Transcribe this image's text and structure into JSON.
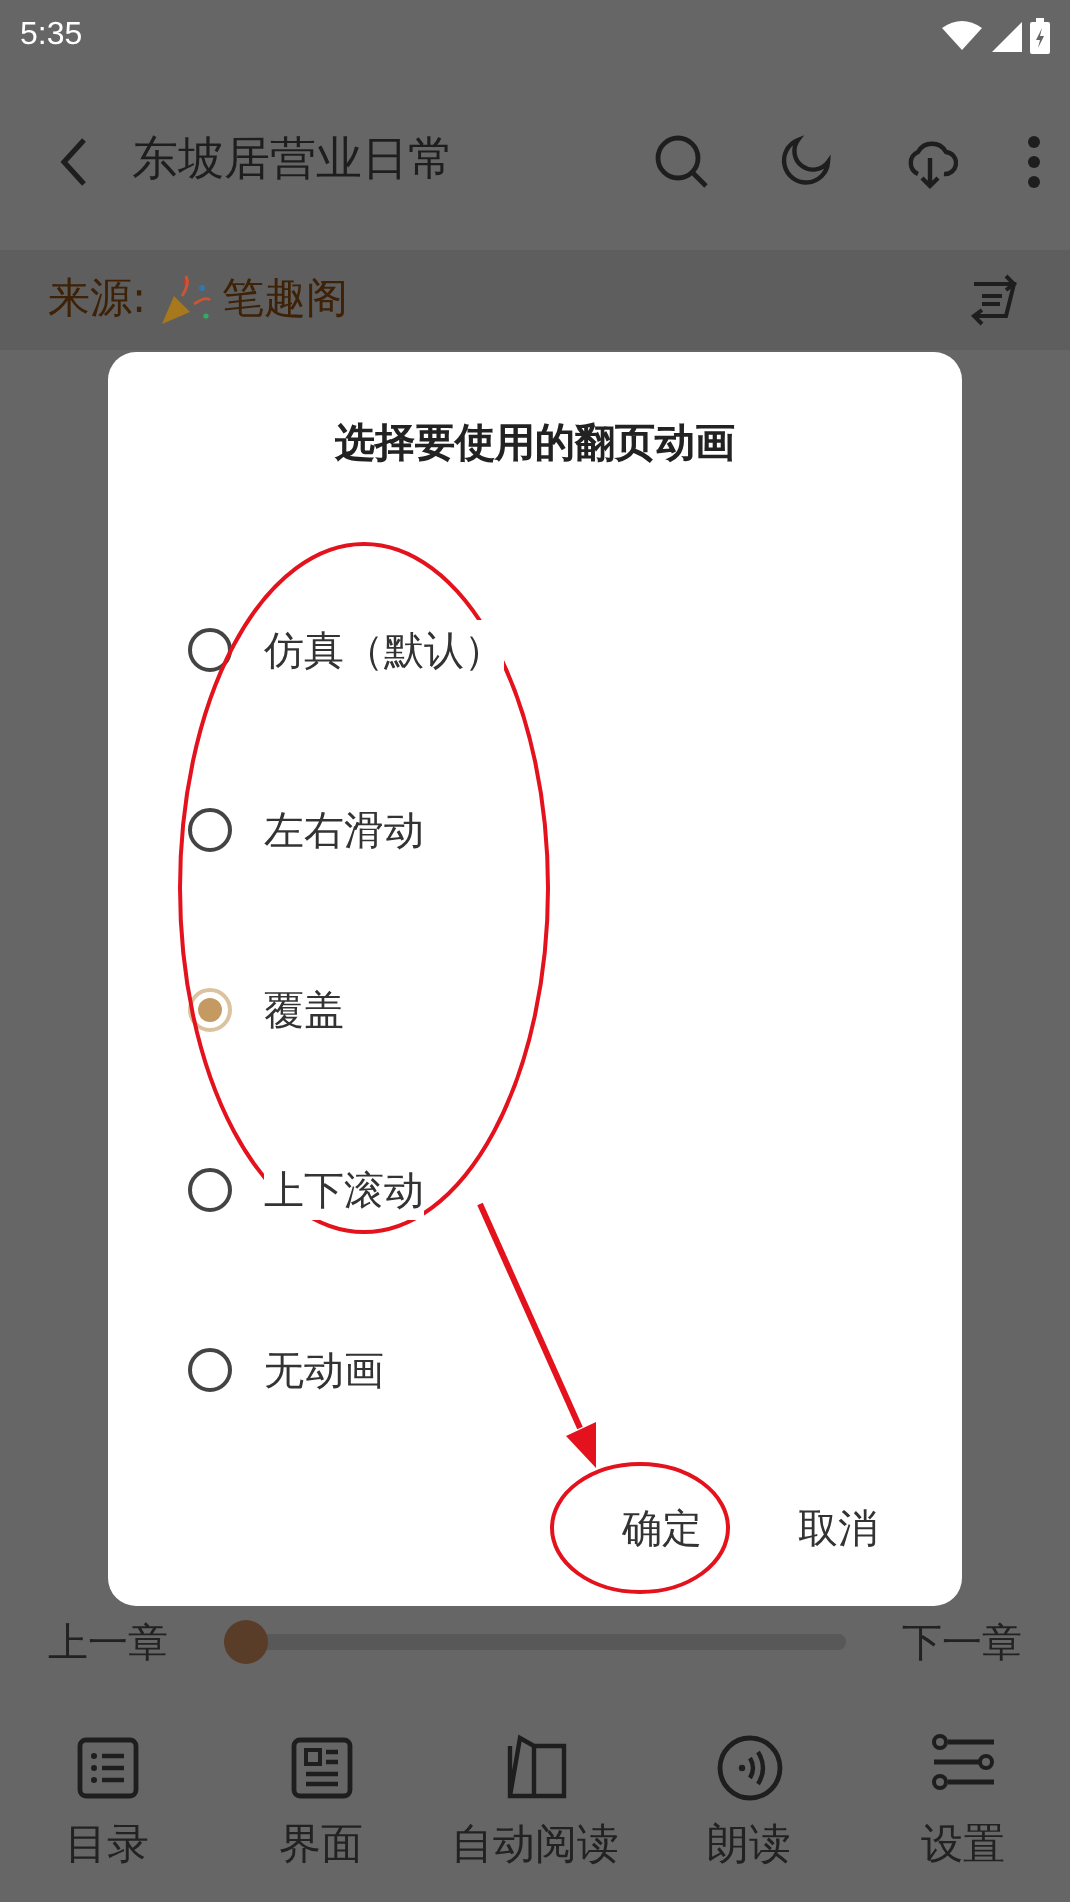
{
  "status_bar": {
    "time": "5:35"
  },
  "top_bar": {
    "title": "东坡居营业日常"
  },
  "source": {
    "label": "来源:",
    "site": "笔趣阁"
  },
  "dialog": {
    "title": "选择要使用的翻页动画",
    "options": [
      {
        "label": "仿真（默认）",
        "selected": false
      },
      {
        "label": "左右滑动",
        "selected": false
      },
      {
        "label": "覆盖",
        "selected": true
      },
      {
        "label": "上下滚动",
        "selected": false
      },
      {
        "label": "无动画",
        "selected": false
      }
    ],
    "buttons": [
      "确定",
      "取消"
    ]
  },
  "chapter_bar": {
    "prev": "上一章",
    "next": "下一章",
    "level": 0.0
  },
  "bottom_nav": [
    {
      "label": "目录",
      "kind": "list"
    },
    {
      "label": "界面",
      "kind": "layout"
    },
    {
      "label": "自动阅读",
      "kind": "book"
    },
    {
      "label": "朗读",
      "kind": "audio"
    },
    {
      "label": "设置",
      "kind": "sliders"
    }
  ]
}
